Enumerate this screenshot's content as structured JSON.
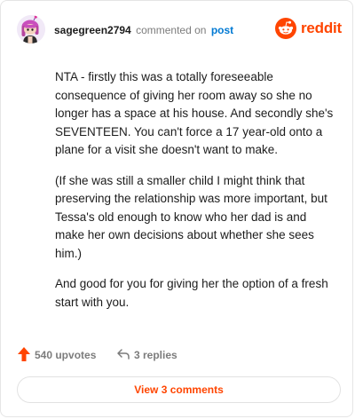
{
  "header": {
    "username": "sagegreen2794",
    "commented_text": "commented on",
    "post_link": "post",
    "logo_text": "reddit"
  },
  "comment": {
    "paragraphs": [
      "NTA - firstly this was a totally foreseeable consequence of giving her room away so she no longer has a space at his house. And secondly she's SEVENTEEN. You can't force a 17 year-old onto a plane for a visit she doesn't want to make.",
      "(If she was still a smaller child I might think that preserving the relationship was more important, but Tessa's old enough to know who her dad is and make her own decisions about whether she sees him.)",
      "And good for you for giving her the option of a fresh start with you."
    ]
  },
  "actions": {
    "upvotes": "540 upvotes",
    "replies": "3 replies"
  },
  "view_comments": "View 3 comments",
  "colors": {
    "brand": "#ff4500",
    "link": "#0079d3",
    "muted": "#7c7c7c"
  }
}
